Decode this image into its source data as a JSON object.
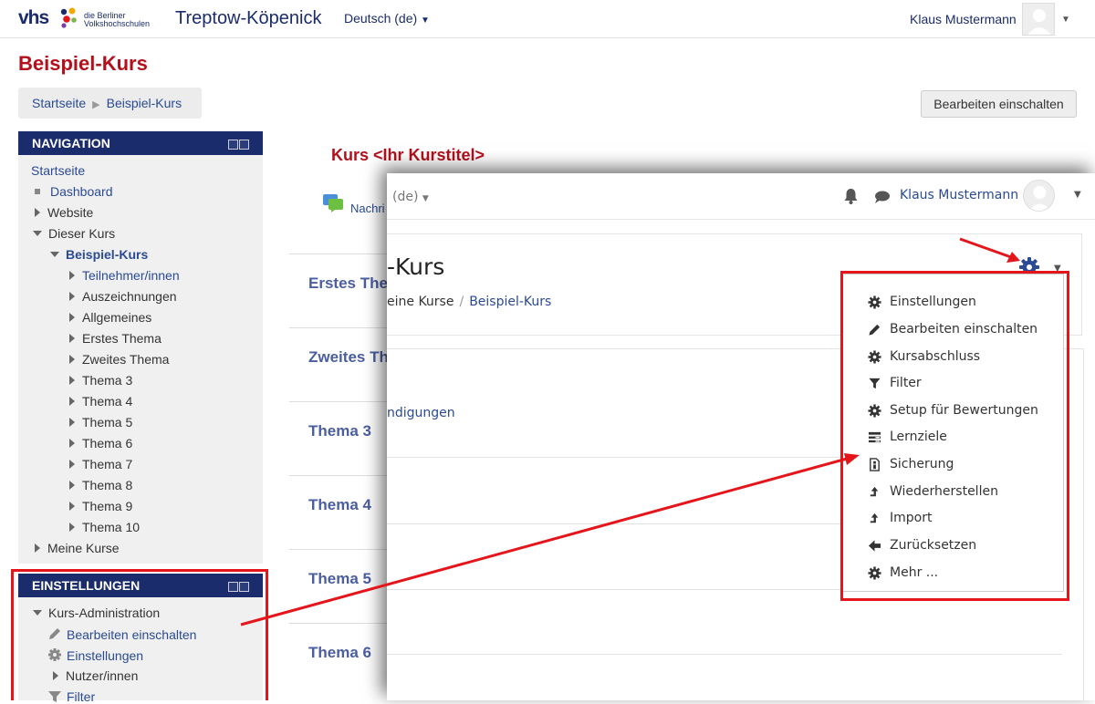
{
  "header": {
    "logo_text": "vhs",
    "logo_line1": "die Berliner",
    "logo_line2": "Volkshochschulen",
    "site_name": "Treptow-Köpenick",
    "language": "Deutsch (de)",
    "user_name": "Klaus Mustermann"
  },
  "page": {
    "title": "Beispiel-Kurs",
    "breadcrumb": [
      "Startseite",
      "Beispiel-Kurs"
    ],
    "edit_button": "Bearbeiten einschalten"
  },
  "navigation": {
    "title": "NAVIGATION",
    "items": [
      {
        "label": "Startseite"
      },
      {
        "label": "Dashboard"
      },
      {
        "label": "Website"
      },
      {
        "label": "Dieser Kurs"
      },
      {
        "label": "Beispiel-Kurs"
      },
      {
        "label": "Teilnehmer/innen"
      },
      {
        "label": "Auszeichnungen"
      },
      {
        "label": "Allgemeines"
      },
      {
        "label": "Erstes Thema"
      },
      {
        "label": "Zweites Thema"
      },
      {
        "label": "Thema 3"
      },
      {
        "label": "Thema 4"
      },
      {
        "label": "Thema 5"
      },
      {
        "label": "Thema 6"
      },
      {
        "label": "Thema 7"
      },
      {
        "label": "Thema 8"
      },
      {
        "label": "Thema 9"
      },
      {
        "label": "Thema 10"
      },
      {
        "label": "Meine Kurse"
      }
    ]
  },
  "settings": {
    "title": "EINSTELLUNGEN",
    "items": [
      {
        "label": "Kurs-Administration"
      },
      {
        "label": "Bearbeiten einschalten"
      },
      {
        "label": "Einstellungen"
      },
      {
        "label": "Nutzer/innen"
      },
      {
        "label": "Filter"
      }
    ]
  },
  "course": {
    "heading": "Kurs <Ihr Kurstitel>",
    "news_label": "Nachri",
    "sections": [
      "Erstes The",
      "Zweites Th",
      "Thema 3",
      "Thema 4",
      "Thema 5",
      "Thema 6"
    ]
  },
  "overlay": {
    "language": "(de)",
    "user_name": "Klaus Mustermann",
    "title": "-Kurs",
    "breadcrumb_prefix": "eine Kurse",
    "breadcrumb_current": "Beispiel-Kurs",
    "content_link": "ndigungen",
    "menu": [
      {
        "label": "Einstellungen",
        "icon": "gear-icon"
      },
      {
        "label": "Bearbeiten einschalten",
        "icon": "pencil-icon"
      },
      {
        "label": "Kursabschluss",
        "icon": "gear-icon"
      },
      {
        "label": "Filter",
        "icon": "filter-icon"
      },
      {
        "label": "Setup für Bewertungen",
        "icon": "gear-icon"
      },
      {
        "label": "Lernziele",
        "icon": "list-icon"
      },
      {
        "label": "Sicherung",
        "icon": "file-icon"
      },
      {
        "label": "Wiederherstellen",
        "icon": "upload-icon"
      },
      {
        "label": "Import",
        "icon": "upload-icon"
      },
      {
        "label": "Zurücksetzen",
        "icon": "arrow-left-icon"
      },
      {
        "label": "Mehr ...",
        "icon": "gear-icon"
      }
    ]
  },
  "colors": {
    "brand_blue": "#1a2c6b",
    "title_red": "#b3101b",
    "highlight_red": "#e4161c",
    "link_blue": "#2a4a94"
  }
}
